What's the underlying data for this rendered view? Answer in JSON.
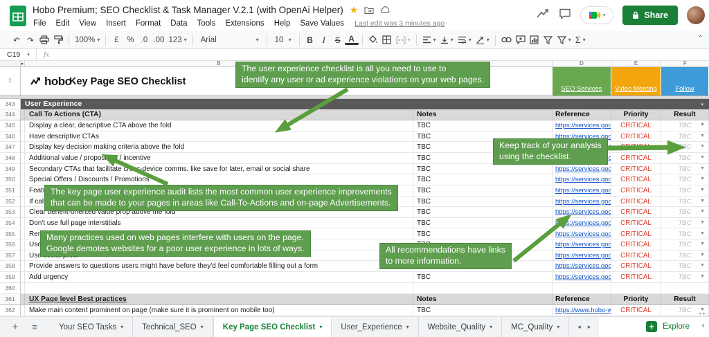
{
  "app": {
    "doc_title": "Hobo Premium; SEO Checklist & Task Manager V.2.1 (with OpenAi Helper)",
    "menu_items": [
      "File",
      "Edit",
      "View",
      "Insert",
      "Format",
      "Data",
      "Tools",
      "Extensions",
      "Help",
      "Save Values"
    ],
    "last_edit": "Last edit was 3 minutes ago",
    "share_label": "Share"
  },
  "toolbar": {
    "zoom": "100%",
    "currency": "£",
    "percent": "%",
    "decimal_decrease": ".0",
    "decimal_increase": ".00",
    "more_formats": "123",
    "font": "Arial",
    "font_size": "10",
    "bold": "B",
    "italic": "I",
    "strikethrough": "S",
    "text_color": "A",
    "functions": "Σ"
  },
  "formula_bar": {
    "name_box": "C19",
    "fx_label": "fx"
  },
  "column_headers": {
    "b": "B",
    "d": "D",
    "e": "E",
    "f": "F"
  },
  "sheet": {
    "first_row_number": "1",
    "logo_text": "hobo",
    "page_title": "Key Page SEO Checklist",
    "banner_links": [
      {
        "label": "SEO Services",
        "bg": "#6aa84f"
      },
      {
        "label": "Video Meeting",
        "bg": "#f2a50c"
      },
      {
        "label": "Follow",
        "bg": "#3d9bd9"
      }
    ],
    "section_header": {
      "row": "343",
      "label": "User Experience"
    },
    "table_header": {
      "row": "344",
      "item": "Call To Actions (CTA)",
      "notes": "Notes",
      "reference": "Reference",
      "priority": "Priority",
      "result": "Result"
    },
    "rows": [
      {
        "row": "345",
        "item": "Display a clear, descriptive CTA above the fold",
        "notes": "TBC",
        "reference": "https://services.goo",
        "priority": "CRITICAL",
        "result": "TBC"
      },
      {
        "row": "346",
        "item": "Have descriptive CTAs",
        "notes": "TBC",
        "reference": "https://services.goo",
        "priority": "CRITICAL",
        "result": "TBC"
      },
      {
        "row": "347",
        "item": "Display key decision making criteria above the fold",
        "notes": "TBC",
        "reference": "https://services.goo",
        "priority": "CRITICAL",
        "result": "TBC"
      },
      {
        "row": "348",
        "item": "Additional value / proposition / incentive",
        "notes": "TBC",
        "reference": "https://services.goo",
        "priority": "CRITICAL",
        "result": "TBC"
      },
      {
        "row": "349",
        "item": "Secondary CTAs that facilitate cross-device comms, like save for later, email or social share",
        "notes": "TBC",
        "reference": "https://services.goo",
        "priority": "CRITICAL",
        "result": "TBC"
      },
      {
        "row": "350",
        "item": "Special Offers / Discounts / Promotions",
        "notes": "TBC",
        "reference": "https://services.goo",
        "priority": "CRITICAL",
        "result": "TBC"
      },
      {
        "row": "351",
        "item": "Feature",
        "notes": "TBC",
        "reference": "https://services.goo",
        "priority": "CRITICAL",
        "result": "TBC"
      },
      {
        "row": "352",
        "item": "If calls a",
        "notes": "TBC",
        "reference": "https://services.goo",
        "priority": "CRITICAL",
        "result": "TBC"
      },
      {
        "row": "353",
        "item": "Clear benefit-oriented value prop above the fold",
        "notes": "TBC",
        "reference": "https://services.goo",
        "priority": "CRITICAL",
        "result": "TBC"
      },
      {
        "row": "354",
        "item": "Don't use full page interstitials",
        "notes": "TBC",
        "reference": "https://services.goo",
        "priority": "CRITICAL",
        "result": "TBC"
      },
      {
        "row": "355",
        "item": "Remo",
        "notes": "TBC",
        "reference": "https://services.goo",
        "priority": "CRITICAL",
        "result": "TBC"
      },
      {
        "row": "356",
        "item": "Use le",
        "notes": "TBC",
        "reference": "https://services.goo",
        "priority": "CRITICAL",
        "result": "TBC"
      },
      {
        "row": "357",
        "item": "Use social proof",
        "notes": "TBC",
        "reference": "https://services.goo",
        "priority": "CRITICAL",
        "result": "TBC"
      },
      {
        "row": "358",
        "item": "Provide answers to questions users might have before they'd feel comfortable filling out a form",
        "notes": "TBC",
        "reference": "https://services.goo",
        "priority": "CRITICAL",
        "result": "TBC"
      },
      {
        "row": "359",
        "item": "Add urgency",
        "notes": "TBC",
        "reference": "https://services.goo",
        "priority": "CRITICAL",
        "result": "TBC"
      }
    ],
    "empty_row": {
      "row": "360"
    },
    "section_header_2": {
      "row": "361",
      "label": "UX Page level Best practices",
      "notes": "Notes",
      "reference": "Reference",
      "priority": "Priority",
      "result": "Result"
    },
    "rows_2": [
      {
        "row": "362",
        "item": "Make main content prominent on page (make sure it is prominent on mobile too)",
        "notes": "TBC",
        "reference": "https://www.hobo-w",
        "priority": "CRITICAL",
        "result": "TBC"
      }
    ]
  },
  "callouts": [
    {
      "id": "c1",
      "lines": [
        "The user experience checklist is all you need to use to",
        "identify any user or ad experience violations on your web pages."
      ]
    },
    {
      "id": "c2",
      "lines": [
        "The key page user experience audit lists the most common user experience improvements",
        "that can be made to your pages in areas like Call-To-Actions and on-page Advertisements."
      ]
    },
    {
      "id": "c3",
      "lines": [
        "Keep track of your analysis",
        "using the checklist."
      ]
    },
    {
      "id": "c4",
      "lines": [
        "Many practices used on web pages interfere with users on the page.",
        "Google demotes websites for a poor user experience in lots of ways."
      ]
    },
    {
      "id": "c5",
      "lines": [
        "All recommendations have links",
        "to more information."
      ]
    }
  ],
  "tabs": {
    "items": [
      {
        "label": "Your SEO Tasks",
        "active": false
      },
      {
        "label": "Technical_SEO",
        "active": false
      },
      {
        "label": "Key Page SEO Checklist",
        "active": true
      },
      {
        "label": "User_Experience",
        "active": false
      },
      {
        "label": "Website_Quality",
        "active": false
      },
      {
        "label": "MC_Quality",
        "active": false
      }
    ],
    "explore_label": "Explore"
  },
  "colors": {
    "callout_green": "#5f9e4f",
    "arrow_green": "#5a9e3d",
    "critical_red": "#dd3b2b",
    "link_blue": "#1155cc",
    "section_gray": "#595959",
    "subheader_gray": "#d9d9d9",
    "tab_green": "#188038",
    "share_green": "#1a8038"
  }
}
